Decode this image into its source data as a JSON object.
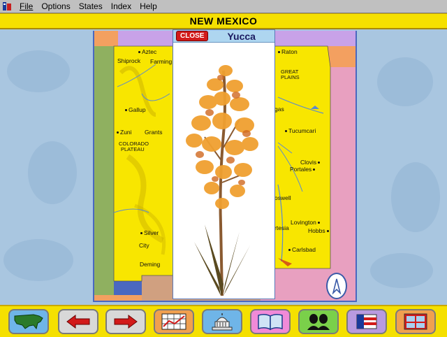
{
  "menu": {
    "items": [
      "File",
      "Options",
      "States",
      "Index",
      "Help"
    ],
    "underline_first_letter": true
  },
  "title": "NEW MEXICO",
  "popup": {
    "close_label": "CLOSE",
    "title": "Yucca"
  },
  "map_labels": {
    "aztec": "Aztec",
    "shiprock": "Shiprock",
    "farmington": "Farming",
    "gallup": "Gallup",
    "zuni": "Zuni",
    "grants": "Grants",
    "colorado_plateau_1": "COLORADO",
    "colorado_plateau_2": "PLATEAU",
    "silver_city_1": "Silver",
    "silver_city_2": "City",
    "deming": "Deming",
    "raton": "Raton",
    "great_plains_1": "GREAT",
    "great_plains_2": "PLAINS",
    "vegas": "gas",
    "tucumcari": "Tucumcari",
    "clovis": "Clovis",
    "portales": "Portales",
    "roswell": "oswell",
    "lovington": "Lovington",
    "artesia": "rtesia",
    "hobbs": "Hobbs",
    "carlsbad": "Carlsbad"
  },
  "toolbar": {
    "buttons": [
      {
        "name": "usa-map-button",
        "icon": "usa-map-icon",
        "color": "#6fb5e8"
      },
      {
        "name": "back-button",
        "icon": "left-arrow-icon",
        "color": "#d8d8d8"
      },
      {
        "name": "forward-button",
        "icon": "right-arrow-icon",
        "color": "#d8d8d8"
      },
      {
        "name": "statistics-button",
        "icon": "chart-icon",
        "color": "#f0a050"
      },
      {
        "name": "capitol-button",
        "icon": "capitol-icon",
        "color": "#6fb5e8"
      },
      {
        "name": "book-button",
        "icon": "book-icon",
        "color": "#f08ad8"
      },
      {
        "name": "people-button",
        "icon": "people-icon",
        "color": "#7ad04a"
      },
      {
        "name": "flag-button",
        "icon": "flag-icon",
        "color": "#b89ae0"
      },
      {
        "name": "window-button",
        "icon": "window-icon",
        "color": "#f0a050"
      }
    ]
  },
  "colors": {
    "title_bar": "#f5e000",
    "map_state": "#f8e600",
    "close_button": "#d21a1a",
    "popup_header": "#aed6f0"
  }
}
